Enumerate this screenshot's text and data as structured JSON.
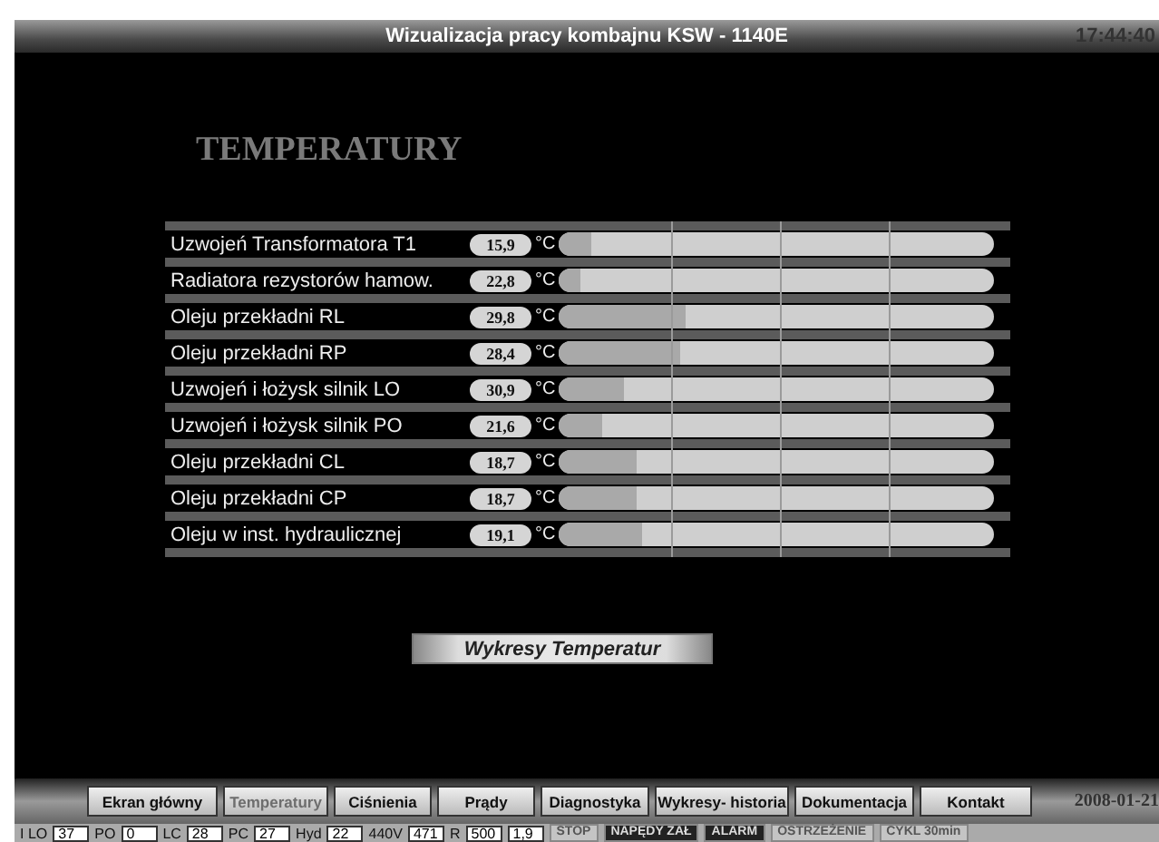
{
  "window": {
    "title": "Wizualizacja pracy kombajnu KSW - 1140E",
    "time": "17:44:40"
  },
  "heading": "TEMPERATURY",
  "temperatures": [
    {
      "name": "Uzwojeń Transformatora T1",
      "value": "15,9",
      "unit": "°C",
      "level": 0.075
    },
    {
      "name": "Radiatora rezystorów hamow.",
      "value": "22,8",
      "unit": "°C",
      "level": 0.05
    },
    {
      "name": "Oleju przekładni RL",
      "value": "29,8",
      "unit": "°C",
      "level": 0.29
    },
    {
      "name": "Oleju przekładni RP",
      "value": "28,4",
      "unit": "°C",
      "level": 0.28
    },
    {
      "name": "Uzwojeń i łożysk silnik LO",
      "value": "30,9",
      "unit": "°C",
      "level": 0.15
    },
    {
      "name": "Uzwojeń i łożysk silnik PO",
      "value": "21,6",
      "unit": "°C",
      "level": 0.1
    },
    {
      "name": "Oleju przekładni CL",
      "value": "18,7",
      "unit": "°C",
      "level": 0.18
    },
    {
      "name": "Oleju przekładni CP",
      "value": "18,7",
      "unit": "°C",
      "level": 0.18
    },
    {
      "name": "Oleju w inst. hydraulicznej",
      "value": "19,1",
      "unit": "°C",
      "level": 0.19
    }
  ],
  "chart_button": "Wykresy Temperatur",
  "nav": [
    {
      "label": "Ekran główny",
      "selected": false
    },
    {
      "label": "Temperatury",
      "selected": true
    },
    {
      "label": "Ciśnienia",
      "selected": false
    },
    {
      "label": "Prądy",
      "selected": false
    },
    {
      "label": "Diagnostyka",
      "selected": false
    },
    {
      "label": "Wykresy- historia",
      "selected": false
    },
    {
      "label": "Dokumentacja",
      "selected": false
    },
    {
      "label": "Kontakt",
      "selected": false
    }
  ],
  "date": "2008-01-21",
  "status_bar": {
    "readings": [
      {
        "label": "I LO",
        "value": "37"
      },
      {
        "label": "PO",
        "value": "0"
      },
      {
        "label": "LC",
        "value": "28"
      },
      {
        "label": "PC",
        "value": "27"
      },
      {
        "label": "Hyd",
        "value": "22"
      },
      {
        "label": "440V",
        "value": "471"
      },
      {
        "label": "R",
        "value": "500"
      },
      {
        "value": "1,9"
      }
    ],
    "indicators": [
      {
        "label": "STOP",
        "on": false
      },
      {
        "label": "NAPĘDY ZAŁ",
        "on": true
      },
      {
        "label": "ALARM",
        "on": true
      },
      {
        "label": "OSTRZEŻENIE",
        "on": false
      },
      {
        "label": "CYKL 30min",
        "on": false
      }
    ]
  }
}
